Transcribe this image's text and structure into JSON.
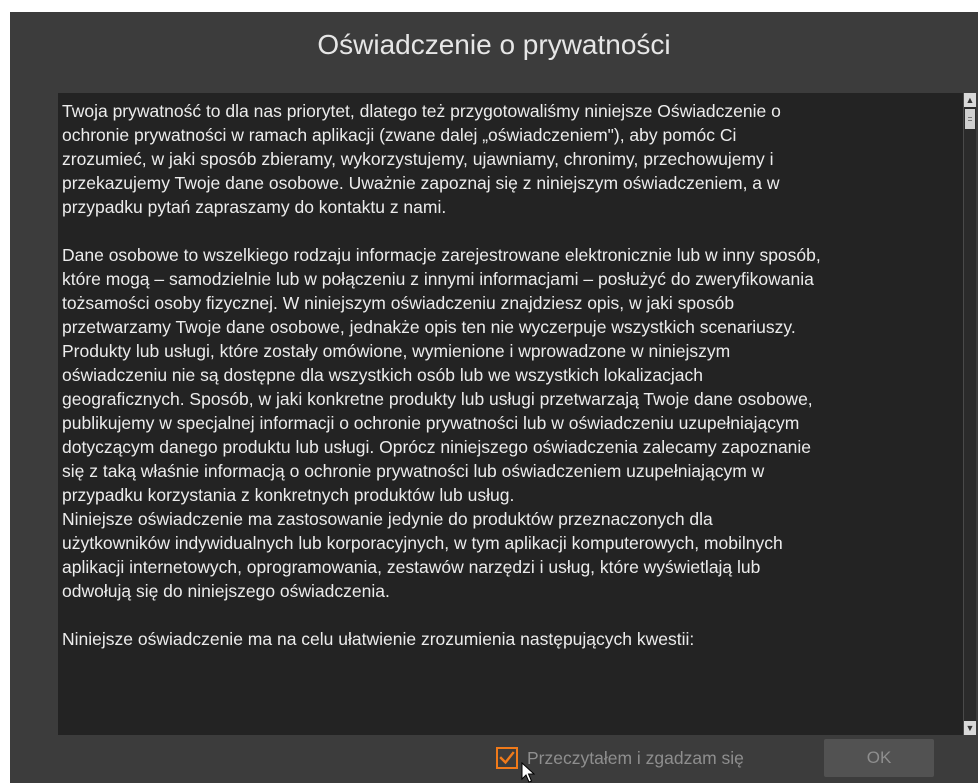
{
  "dialog": {
    "title": "Oświadczenie o prywatności",
    "paragraphs": [
      "Twoja prywatność to dla nas priorytet, dlatego też przygotowaliśmy niniejsze Oświadczenie o\nochronie prywatności w ramach aplikacji (zwane dalej „oświadczeniem\"), aby pomóc Ci\nzrozumieć, w jaki sposób zbieramy, wykorzystujemy, ujawniamy, chronimy, przechowujemy i\nprzekazujemy Twoje dane osobowe. Uważnie zapoznaj się z niniejszym oświadczeniem, a w\nprzypadku pytań zapraszamy do kontaktu z nami.",
      "Dane osobowe to wszelkiego rodzaju informacje zarejestrowane elektronicznie lub w inny sposób,\nktóre mogą – samodzielnie lub w połączeniu z innymi informacjami – posłużyć do zweryfikowania\ntożsamości osoby fizycznej. W niniejszym oświadczeniu znajdziesz opis, w jaki sposób\nprzetwarzamy Twoje dane osobowe, jednakże opis ten nie wyczerpuje wszystkich scenariuszy.\nProdukty lub usługi, które zostały omówione, wymienione i wprowadzone w niniejszym\noświadczeniu nie są dostępne dla wszystkich osób lub we wszystkich lokalizacjach\ngeograficznych. Sposób, w jaki konkretne produkty lub usługi przetwarzają Twoje dane osobowe,\npublikujemy w specjalnej informacji o ochronie prywatności lub w oświadczeniu uzupełniającym\ndotyczącym danego produktu lub usługi. Oprócz niniejszego oświadczenia zalecamy zapoznanie\nsię z taką właśnie informacją o ochronie prywatności lub oświadczeniem uzupełniającym w\nprzypadku korzystania z konkretnych produktów lub usług.",
      "Niniejsze oświadczenie ma zastosowanie jedynie do produktów przeznaczonych dla\nużytkowników indywidualnych lub korporacyjnych, w tym aplikacji komputerowych, mobilnych\naplikacji internetowych, oprogramowania, zestawów narzędzi i usług, które wyświetlają lub\nodwołują się do niniejszego oświadczenia.",
      "Niniejsze oświadczenie ma na celu ułatwienie zrozumienia następujących kwestii:"
    ],
    "agree_label": "Przeczytałem i zgadzam się",
    "agree_checked": true,
    "ok_label": "OK",
    "colors": {
      "accent": "#f07a1a",
      "background": "#3c3c3c",
      "content_background": "#232323",
      "text": "#ececec",
      "disabled_text": "#8e8e8e"
    }
  }
}
